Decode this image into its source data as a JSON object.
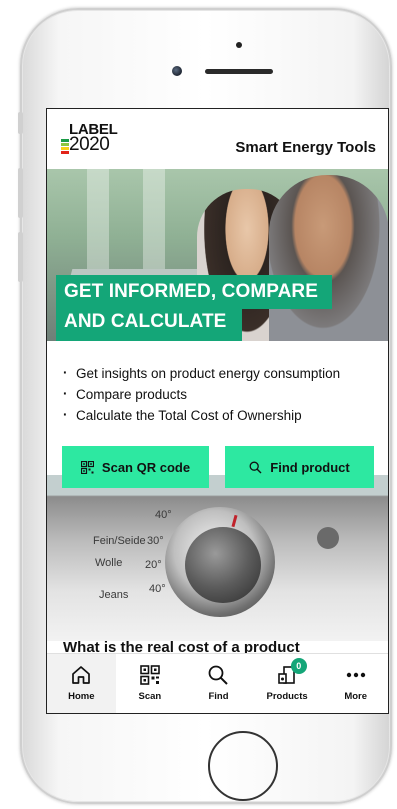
{
  "header": {
    "logo_top": "LABEL",
    "logo_bottom": "2020",
    "app_title": "Smart Energy Tools"
  },
  "hero": {
    "headline_line1": "GET INFORMED, COMPARE",
    "headline_line2": "AND CALCULATE"
  },
  "features": [
    "Get insights on product energy consumption",
    "Compare products",
    "Calculate the Total Cost of Ownership"
  ],
  "actions": {
    "scan_label": "Scan QR code",
    "find_label": "Find product"
  },
  "dial": {
    "labels": [
      "40°",
      "Fein/Seide",
      "30°",
      "Wolle",
      "20°",
      "40°",
      "Jeans"
    ]
  },
  "section": {
    "heading": "What is the real cost of a product"
  },
  "nav": {
    "items": [
      {
        "label": "Home",
        "icon": "home-icon"
      },
      {
        "label": "Scan",
        "icon": "qr-icon"
      },
      {
        "label": "Find",
        "icon": "search-icon"
      },
      {
        "label": "Products",
        "icon": "products-icon"
      },
      {
        "label": "More",
        "icon": "more-icon"
      }
    ],
    "products_badge": "0"
  },
  "colors": {
    "brand_green": "#14a678",
    "button_green": "#2de8a1"
  }
}
